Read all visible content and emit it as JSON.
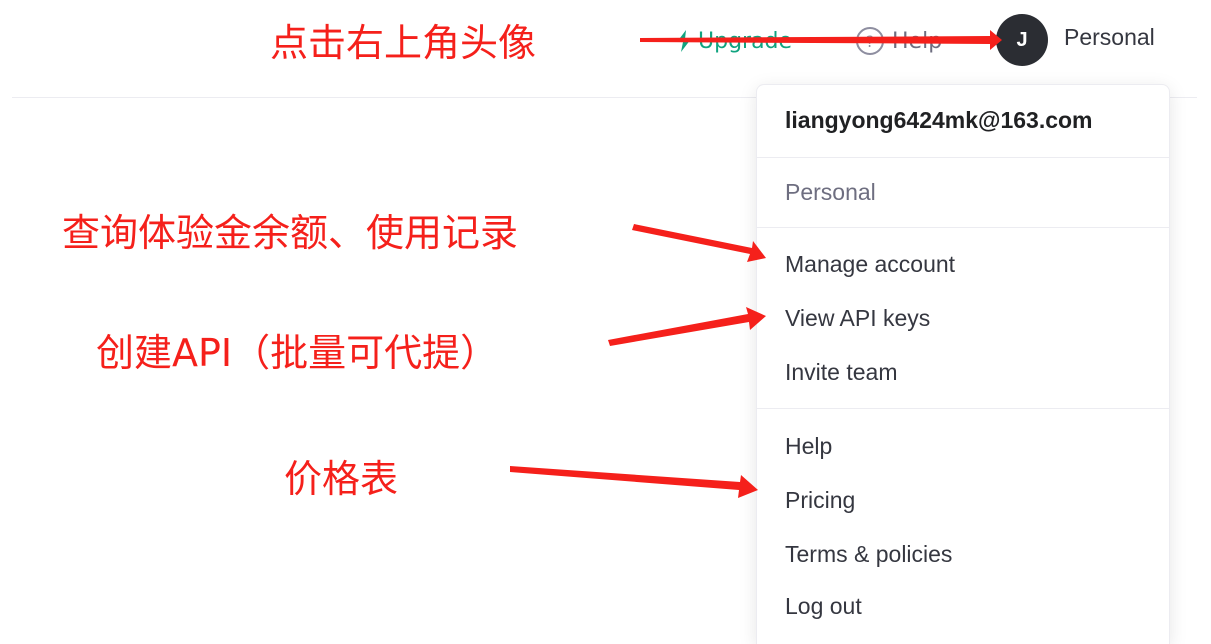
{
  "topbar": {
    "upgrade_label": "Upgrade",
    "help_label": "Help",
    "help_glyph": "?",
    "avatar_initial": "J",
    "org_name": "Personal"
  },
  "menu": {
    "email": "liangyong6424mk@163.com",
    "org": "Personal",
    "items": [
      {
        "label": "Manage account"
      },
      {
        "label": "View API keys"
      },
      {
        "label": "Invite team"
      },
      {
        "label": "Help"
      },
      {
        "label": "Pricing"
      },
      {
        "label": "Terms & policies"
      },
      {
        "label": "Log out"
      }
    ]
  },
  "annotations": {
    "click_avatar": "点击右上角头像",
    "check_balance": "查询体验金余额、使用记录",
    "create_api": "创建API（批量可代提）",
    "pricing": "价格表"
  },
  "colors": {
    "accent": "#10a37f",
    "annotation": "#f5201b",
    "avatar_bg": "#2b2d33"
  }
}
